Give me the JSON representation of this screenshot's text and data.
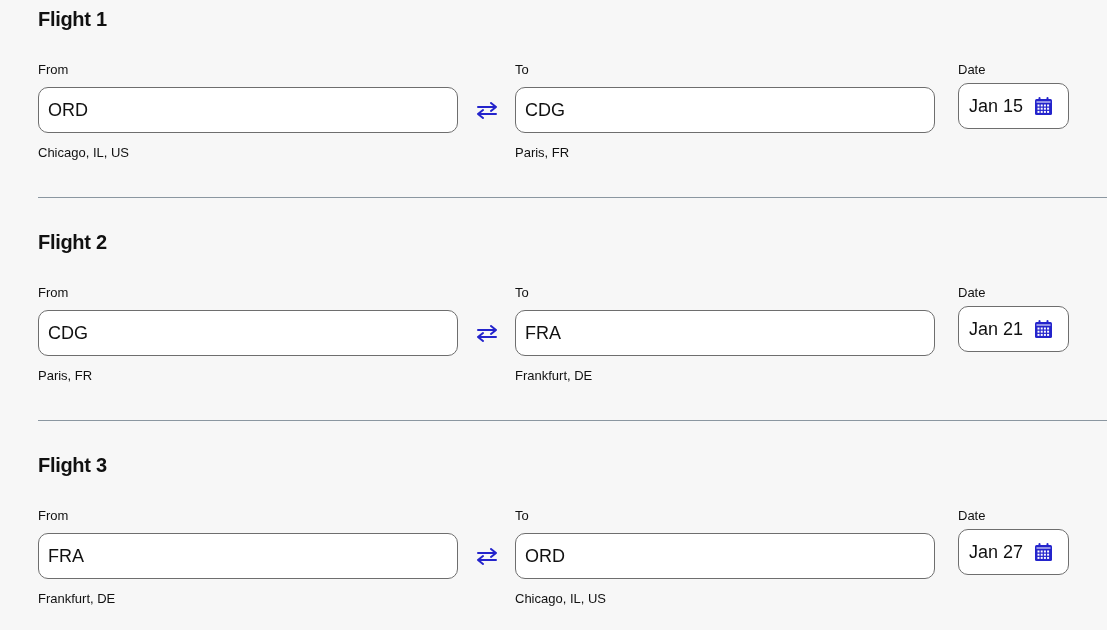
{
  "flights": [
    {
      "title": "Flight 1",
      "from": {
        "label": "From",
        "value": "ORD",
        "city": "Chicago, IL, US"
      },
      "to": {
        "label": "To",
        "value": "CDG",
        "city": "Paris, FR"
      },
      "date": {
        "label": "Date",
        "value": "Jan 15"
      }
    },
    {
      "title": "Flight 2",
      "from": {
        "label": "From",
        "value": "CDG",
        "city": "Paris, FR"
      },
      "to": {
        "label": "To",
        "value": "FRA",
        "city": "Frankfurt, DE"
      },
      "date": {
        "label": "Date",
        "value": "Jan 21"
      }
    },
    {
      "title": "Flight 3",
      "from": {
        "label": "From",
        "value": "FRA",
        "city": "Frankfurt, DE"
      },
      "to": {
        "label": "To",
        "value": "ORD",
        "city": "Chicago, IL, US"
      },
      "date": {
        "label": "Date",
        "value": "Jan 27"
      }
    }
  ]
}
